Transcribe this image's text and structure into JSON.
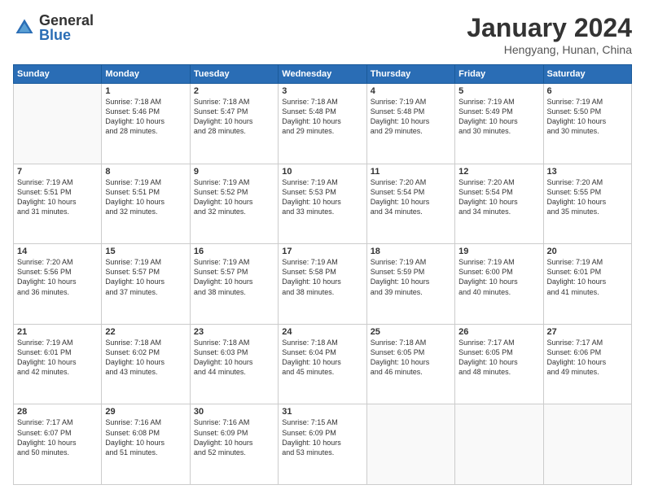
{
  "header": {
    "logo_general": "General",
    "logo_blue": "Blue",
    "month_title": "January 2024",
    "location": "Hengyang, Hunan, China"
  },
  "weekdays": [
    "Sunday",
    "Monday",
    "Tuesday",
    "Wednesday",
    "Thursday",
    "Friday",
    "Saturday"
  ],
  "weeks": [
    [
      {
        "day": "",
        "info": ""
      },
      {
        "day": "1",
        "info": "Sunrise: 7:18 AM\nSunset: 5:46 PM\nDaylight: 10 hours\nand 28 minutes."
      },
      {
        "day": "2",
        "info": "Sunrise: 7:18 AM\nSunset: 5:47 PM\nDaylight: 10 hours\nand 28 minutes."
      },
      {
        "day": "3",
        "info": "Sunrise: 7:18 AM\nSunset: 5:48 PM\nDaylight: 10 hours\nand 29 minutes."
      },
      {
        "day": "4",
        "info": "Sunrise: 7:19 AM\nSunset: 5:48 PM\nDaylight: 10 hours\nand 29 minutes."
      },
      {
        "day": "5",
        "info": "Sunrise: 7:19 AM\nSunset: 5:49 PM\nDaylight: 10 hours\nand 30 minutes."
      },
      {
        "day": "6",
        "info": "Sunrise: 7:19 AM\nSunset: 5:50 PM\nDaylight: 10 hours\nand 30 minutes."
      }
    ],
    [
      {
        "day": "7",
        "info": "Sunrise: 7:19 AM\nSunset: 5:51 PM\nDaylight: 10 hours\nand 31 minutes."
      },
      {
        "day": "8",
        "info": "Sunrise: 7:19 AM\nSunset: 5:51 PM\nDaylight: 10 hours\nand 32 minutes."
      },
      {
        "day": "9",
        "info": "Sunrise: 7:19 AM\nSunset: 5:52 PM\nDaylight: 10 hours\nand 32 minutes."
      },
      {
        "day": "10",
        "info": "Sunrise: 7:19 AM\nSunset: 5:53 PM\nDaylight: 10 hours\nand 33 minutes."
      },
      {
        "day": "11",
        "info": "Sunrise: 7:20 AM\nSunset: 5:54 PM\nDaylight: 10 hours\nand 34 minutes."
      },
      {
        "day": "12",
        "info": "Sunrise: 7:20 AM\nSunset: 5:54 PM\nDaylight: 10 hours\nand 34 minutes."
      },
      {
        "day": "13",
        "info": "Sunrise: 7:20 AM\nSunset: 5:55 PM\nDaylight: 10 hours\nand 35 minutes."
      }
    ],
    [
      {
        "day": "14",
        "info": "Sunrise: 7:20 AM\nSunset: 5:56 PM\nDaylight: 10 hours\nand 36 minutes."
      },
      {
        "day": "15",
        "info": "Sunrise: 7:19 AM\nSunset: 5:57 PM\nDaylight: 10 hours\nand 37 minutes."
      },
      {
        "day": "16",
        "info": "Sunrise: 7:19 AM\nSunset: 5:57 PM\nDaylight: 10 hours\nand 38 minutes."
      },
      {
        "day": "17",
        "info": "Sunrise: 7:19 AM\nSunset: 5:58 PM\nDaylight: 10 hours\nand 38 minutes."
      },
      {
        "day": "18",
        "info": "Sunrise: 7:19 AM\nSunset: 5:59 PM\nDaylight: 10 hours\nand 39 minutes."
      },
      {
        "day": "19",
        "info": "Sunrise: 7:19 AM\nSunset: 6:00 PM\nDaylight: 10 hours\nand 40 minutes."
      },
      {
        "day": "20",
        "info": "Sunrise: 7:19 AM\nSunset: 6:01 PM\nDaylight: 10 hours\nand 41 minutes."
      }
    ],
    [
      {
        "day": "21",
        "info": "Sunrise: 7:19 AM\nSunset: 6:01 PM\nDaylight: 10 hours\nand 42 minutes."
      },
      {
        "day": "22",
        "info": "Sunrise: 7:18 AM\nSunset: 6:02 PM\nDaylight: 10 hours\nand 43 minutes."
      },
      {
        "day": "23",
        "info": "Sunrise: 7:18 AM\nSunset: 6:03 PM\nDaylight: 10 hours\nand 44 minutes."
      },
      {
        "day": "24",
        "info": "Sunrise: 7:18 AM\nSunset: 6:04 PM\nDaylight: 10 hours\nand 45 minutes."
      },
      {
        "day": "25",
        "info": "Sunrise: 7:18 AM\nSunset: 6:05 PM\nDaylight: 10 hours\nand 46 minutes."
      },
      {
        "day": "26",
        "info": "Sunrise: 7:17 AM\nSunset: 6:05 PM\nDaylight: 10 hours\nand 48 minutes."
      },
      {
        "day": "27",
        "info": "Sunrise: 7:17 AM\nSunset: 6:06 PM\nDaylight: 10 hours\nand 49 minutes."
      }
    ],
    [
      {
        "day": "28",
        "info": "Sunrise: 7:17 AM\nSunset: 6:07 PM\nDaylight: 10 hours\nand 50 minutes."
      },
      {
        "day": "29",
        "info": "Sunrise: 7:16 AM\nSunset: 6:08 PM\nDaylight: 10 hours\nand 51 minutes."
      },
      {
        "day": "30",
        "info": "Sunrise: 7:16 AM\nSunset: 6:09 PM\nDaylight: 10 hours\nand 52 minutes."
      },
      {
        "day": "31",
        "info": "Sunrise: 7:15 AM\nSunset: 6:09 PM\nDaylight: 10 hours\nand 53 minutes."
      },
      {
        "day": "",
        "info": ""
      },
      {
        "day": "",
        "info": ""
      },
      {
        "day": "",
        "info": ""
      }
    ]
  ]
}
